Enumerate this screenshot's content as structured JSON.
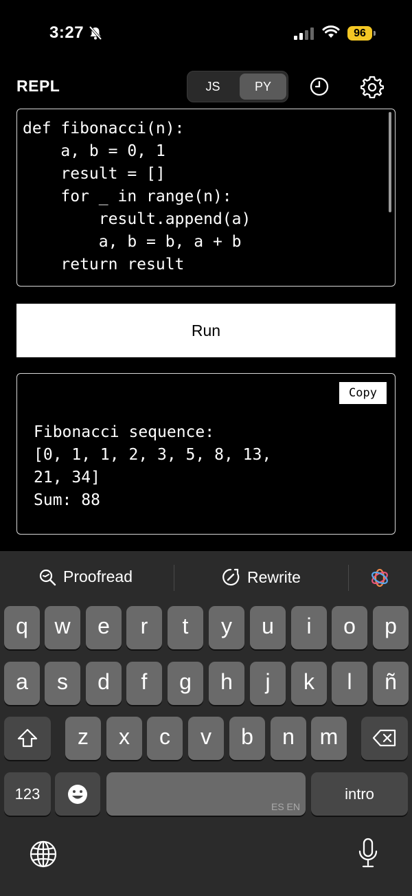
{
  "status": {
    "time": "3:27",
    "battery": "96"
  },
  "header": {
    "title": "REPL",
    "tabs": [
      {
        "label": "JS"
      },
      {
        "label": "PY",
        "selected": true
      }
    ]
  },
  "editor": {
    "code": "def fibonacci(n):\n    a, b = 0, 1\n    result = []\n    for _ in range(n):\n        result.append(a)\n        a, b = b, a + b\n    return result"
  },
  "run_label": "Run",
  "output": {
    "copy_label": "Copy",
    "text": "Fibonacci sequence:\n[0, 1, 1, 2, 3, 5, 8, 13,\n21, 34]\nSum: 88"
  },
  "keyboard": {
    "suggestions": {
      "proofread": "Proofread",
      "rewrite": "Rewrite"
    },
    "row1": [
      "q",
      "w",
      "e",
      "r",
      "t",
      "y",
      "u",
      "i",
      "o",
      "p"
    ],
    "row2": [
      "a",
      "s",
      "d",
      "f",
      "g",
      "h",
      "j",
      "k",
      "l",
      "ñ"
    ],
    "row3": [
      "z",
      "x",
      "c",
      "v",
      "b",
      "n",
      "m"
    ],
    "numbers_label": "123",
    "space_label": "ES EN",
    "return_label": "intro"
  },
  "colors": {
    "battery": "#f4c724",
    "keyboard_bg": "#2b2b2b",
    "key": "#6a6a6a",
    "key_dark": "#474747"
  }
}
